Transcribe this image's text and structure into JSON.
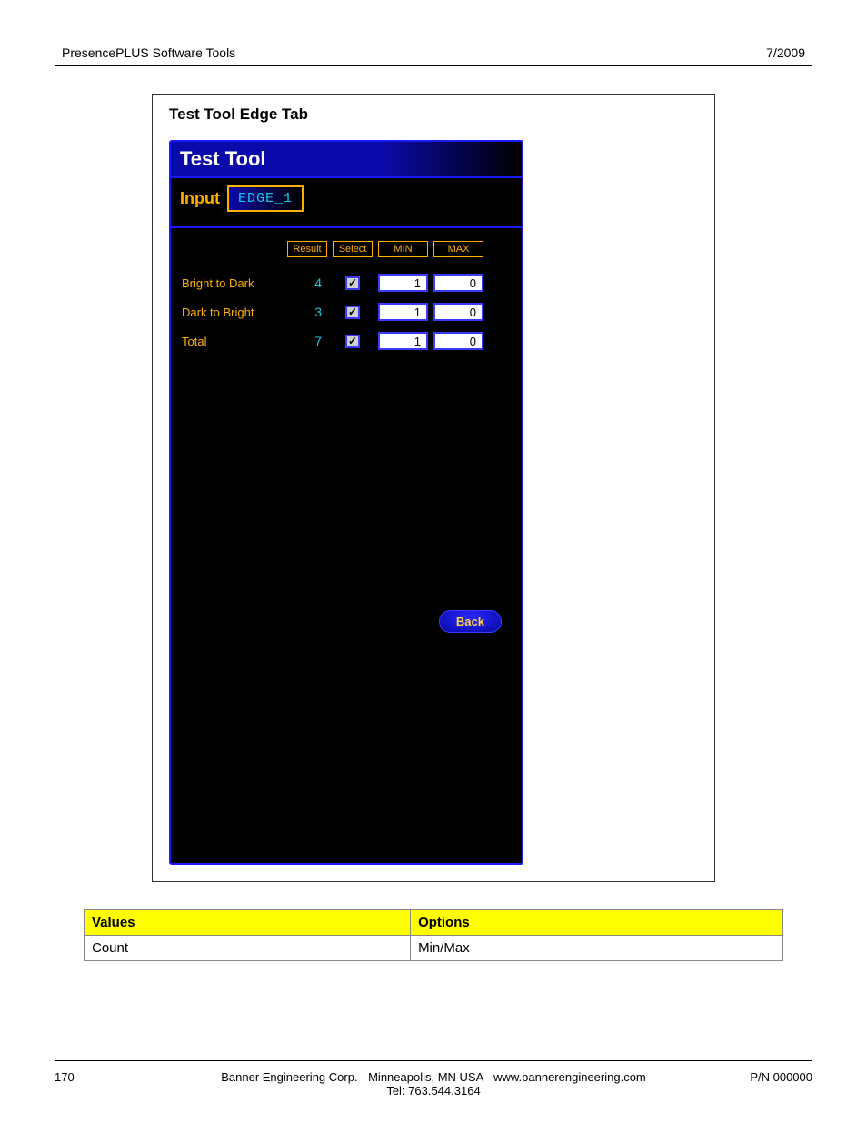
{
  "header": {
    "left": "PresencePLUS Software Tools",
    "right": "7/2009"
  },
  "panel": {
    "title": "Test Tool Edge Tab",
    "tool_title": "Test Tool",
    "input_label": "Input",
    "input_value": "EDGE_1",
    "col_headers": {
      "result": "Result",
      "select": "Select",
      "min": "MIN",
      "max": "MAX"
    },
    "rows": [
      {
        "label": "Bright to Dark",
        "result": "4",
        "min": "1",
        "max": "0"
      },
      {
        "label": "Dark to Bright",
        "result": "3",
        "min": "1",
        "max": "0"
      },
      {
        "label": "Total",
        "result": "7",
        "min": "1",
        "max": "0"
      }
    ],
    "back": "Back"
  },
  "values_table": {
    "headers": {
      "values": "Values",
      "options": "Options"
    },
    "cells": {
      "values": "Count",
      "options": "Min/Max"
    }
  },
  "footer": {
    "page": "170",
    "center1": "Banner Engineering Corp. - Minneapolis, MN USA - www.bannerengineering.com",
    "center2": "Tel: 763.544.3164",
    "pn": "P/N 000000"
  }
}
